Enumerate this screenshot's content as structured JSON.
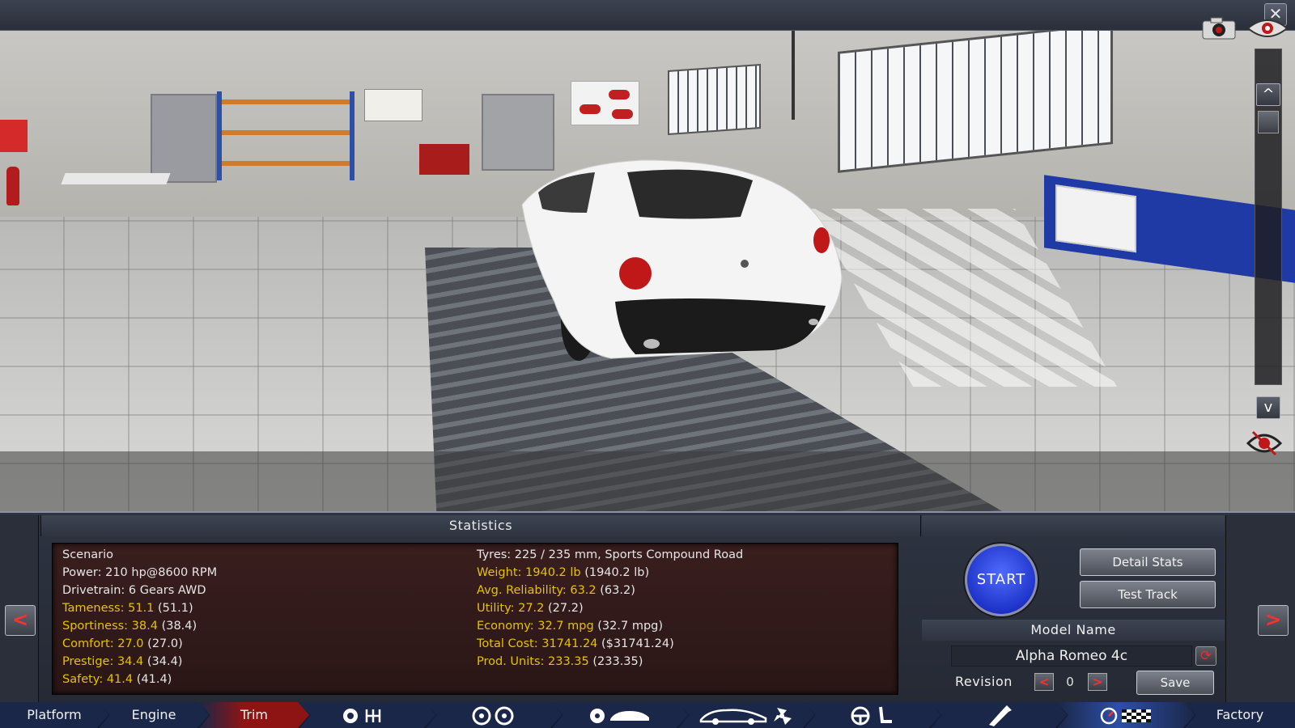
{
  "window": {
    "close_icon": "close-icon",
    "close_glyph": "✕"
  },
  "viewport": {
    "controls": {
      "camera_icon": "camera-icon",
      "eye_icon": "eye-icon",
      "scroll_up": "^",
      "scroll_down": "v",
      "reset_icon": "reset-view-icon"
    }
  },
  "stats_panel": {
    "title": "Statistics",
    "prev_arrow": "<",
    "next_arrow": ">",
    "left_column": [
      {
        "key": "Scenario",
        "value": "",
        "highlight": false
      },
      {
        "key": "Power:",
        "value": "210 hp@8600 RPM",
        "highlight": false
      },
      {
        "key": "Drivetrain:",
        "value": "6 Gears AWD",
        "highlight": false
      },
      {
        "key": "Tameness:",
        "value": "51.1",
        "extra": "(51.1)",
        "highlight": true
      },
      {
        "key": "Sportiness:",
        "value": "38.4",
        "extra": "(38.4)",
        "highlight": true
      },
      {
        "key": "Comfort:",
        "value": "27.0",
        "extra": "(27.0)",
        "highlight": true
      },
      {
        "key": "Prestige:",
        "value": "34.4",
        "extra": "(34.4)",
        "highlight": true
      },
      {
        "key": "Safety:",
        "value": "41.4",
        "extra": "(41.4)",
        "highlight": true
      }
    ],
    "right_column": [
      {
        "key": "Tyres:",
        "value": "225 / 235 mm, Sports Compound Road",
        "highlight": false
      },
      {
        "key": "Weight:",
        "value": "1940.2 lb",
        "extra": "(1940.2 lb)",
        "highlight": true
      },
      {
        "key": "Avg. Reliability:",
        "value": "63.2",
        "extra": "(63.2)",
        "highlight": true
      },
      {
        "key": "Utility:",
        "value": "27.2",
        "extra": "(27.2)",
        "highlight": true
      },
      {
        "key": "Economy:",
        "value": "32.7 mpg",
        "extra": "(32.7 mpg)",
        "highlight": true
      },
      {
        "key": "Total Cost:",
        "value": "31741.24",
        "extra": "($31741.24)",
        "highlight": true
      },
      {
        "key": "Prod. Units:",
        "value": "233.35",
        "extra": "(233.35)",
        "highlight": true
      }
    ]
  },
  "actions": {
    "start_label": "START",
    "detail_stats_label": "Detail Stats",
    "test_track_label": "Test Track",
    "model_name_label": "Model Name",
    "model_name_value": "Alpha Romeo 4c",
    "refresh_icon": "refresh-icon",
    "revision_label": "Revision",
    "revision_value": "0",
    "revision_prev": "<",
    "revision_next": ">",
    "save_label": "Save"
  },
  "bottom_nav": {
    "items": [
      {
        "label": "Platform",
        "active": false
      },
      {
        "label": "Engine",
        "active": false
      },
      {
        "label": "Trim",
        "active": true
      },
      {
        "label": "",
        "icon": "gearbox-icon"
      },
      {
        "label": "",
        "icon": "wheels-icon"
      },
      {
        "label": "",
        "icon": "body-icon"
      },
      {
        "label": "",
        "icon": "aero-icon"
      },
      {
        "label": "",
        "icon": "interior-icon"
      },
      {
        "label": "",
        "icon": "tuning-icon"
      },
      {
        "label": "",
        "icon": "testing-icon"
      },
      {
        "label": "Factory",
        "active": false
      }
    ],
    "colors": {
      "active": "#8e1414",
      "normal": "#1a2748",
      "testing": "#2d4fa8"
    }
  }
}
